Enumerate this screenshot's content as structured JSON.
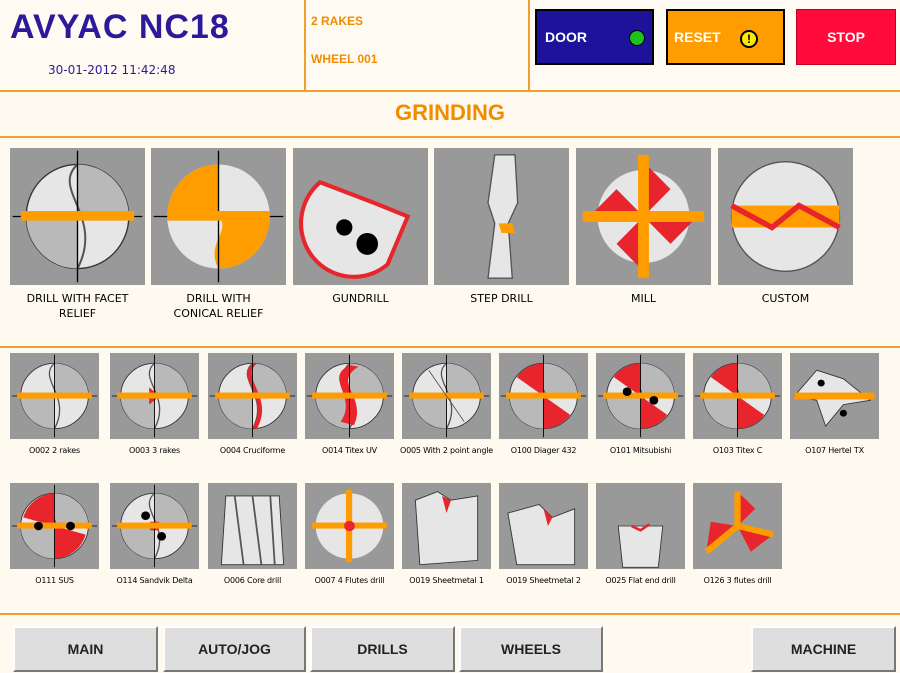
{
  "header": {
    "logo": "AVYAC  NC18",
    "datetime": "30-01-2012 11:42:48",
    "info_line1": "2 RAKES",
    "info_line2": "WHEEL 001",
    "door_label": "DOOR",
    "reset_label": "RESET",
    "stop_label": "STOP",
    "reset_icon": "!"
  },
  "title": "GRINDING",
  "categories": [
    {
      "label": "DRILL WITH FACET\nRELIEF",
      "icon": "drill-facet"
    },
    {
      "label": "DRILL WITH\nCONICAL RELIEF",
      "icon": "drill-conical"
    },
    {
      "label": "GUNDRILL",
      "icon": "gundrill"
    },
    {
      "label": "STEP DRILL",
      "icon": "step-drill"
    },
    {
      "label": "MILL",
      "icon": "mill"
    },
    {
      "label": "CUSTOM",
      "icon": "custom"
    }
  ],
  "tools_row1": [
    {
      "label": "O002 2 rakes",
      "icon": "drill-gray"
    },
    {
      "label": "O003 3 rakes",
      "icon": "drill-gray-red"
    },
    {
      "label": "O004 Cruciforme",
      "icon": "drill-red-s"
    },
    {
      "label": "O014 Titex UV",
      "icon": "drill-red-big"
    },
    {
      "label": "O005 With 2 point angle",
      "icon": "drill-gray-lines"
    },
    {
      "label": "O100 Diager 432",
      "icon": "drill-red-wedges"
    },
    {
      "label": "O101 Mitsubishi",
      "icon": "drill-red-dots"
    },
    {
      "label": "O103 Titex C",
      "icon": "drill-red-wedges"
    },
    {
      "label": "O107 Hertel TX",
      "icon": "insert"
    }
  ],
  "tools_row2": [
    {
      "label": "O111 SUS",
      "icon": "drill-red-dots2"
    },
    {
      "label": "O114 Sandvik Delta",
      "icon": "drill-sandvik"
    },
    {
      "label": "O006 Core drill",
      "icon": "core-drill"
    },
    {
      "label": "O007 4 Flutes drill",
      "icon": "drill-4flute"
    },
    {
      "label": "O019 Sheetmetal 1",
      "icon": "sheet1"
    },
    {
      "label": "O019 Sheetmetal 2",
      "icon": "sheet2"
    },
    {
      "label": "O025 Flat end drill",
      "icon": "flat-end"
    },
    {
      "label": "O126 3 flutes drill",
      "icon": "three-flute"
    }
  ],
  "nav": {
    "main": "MAIN",
    "autojog": "AUTO/JOG",
    "drills": "DRILLS",
    "wheels": "WHEELS",
    "machine": "MACHINE"
  },
  "colors": {
    "accent": "#f08c00",
    "brand": "#2c1a9b",
    "door": "#1c139a",
    "reset": "#ff9c00",
    "stop": "#ff0a3a",
    "red": "#e8242c"
  }
}
